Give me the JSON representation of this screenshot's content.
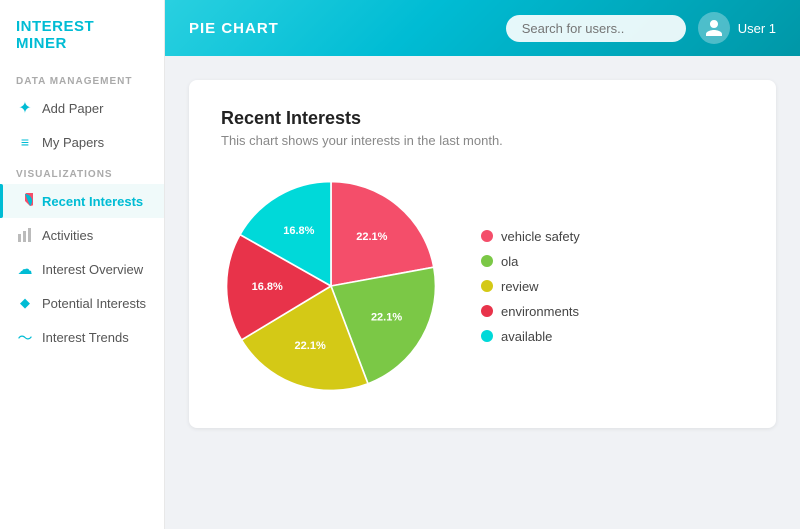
{
  "sidebar": {
    "logo": "INTEREST MINER",
    "sections": [
      {
        "label": "DATA MANAGEMENT",
        "items": [
          {
            "id": "add-paper",
            "label": "Add Paper",
            "icon": "plus",
            "active": false
          },
          {
            "id": "my-papers",
            "label": "My Papers",
            "icon": "list",
            "active": false
          }
        ]
      },
      {
        "label": "VISUALIZATIONS",
        "items": [
          {
            "id": "recent-interests",
            "label": "Recent Interests",
            "icon": "pie",
            "active": true
          },
          {
            "id": "activities",
            "label": "Activities",
            "icon": "bar",
            "active": false
          },
          {
            "id": "interest-overview",
            "label": "Interest Overview",
            "icon": "cloud",
            "active": false
          },
          {
            "id": "potential-interests",
            "label": "Potential Interests",
            "icon": "diamond",
            "active": false
          },
          {
            "id": "interest-trends",
            "label": "Interest Trends",
            "icon": "wave",
            "active": false
          }
        ]
      }
    ]
  },
  "header": {
    "title": "PIE CHART",
    "search_placeholder": "Search for users..",
    "user_label": "User 1"
  },
  "card": {
    "title": "Recent Interests",
    "subtitle": "This chart shows your interests in the last month.",
    "segments": [
      {
        "label": "vehicle safety",
        "value": 22.1,
        "color": "#f44e6a",
        "startAngle": 0
      },
      {
        "label": "ola",
        "value": 22.1,
        "color": "#7bc846",
        "startAngle": 79.56
      },
      {
        "label": "review",
        "value": 22.1,
        "color": "#d4c916",
        "startAngle": 159.12
      },
      {
        "label": "environments",
        "value": 16.8,
        "color": "#e8334a",
        "startAngle": 238.68
      },
      {
        "label": "available",
        "value": 16.8,
        "color": "#00d9d9",
        "startAngle": 299.16
      }
    ]
  }
}
